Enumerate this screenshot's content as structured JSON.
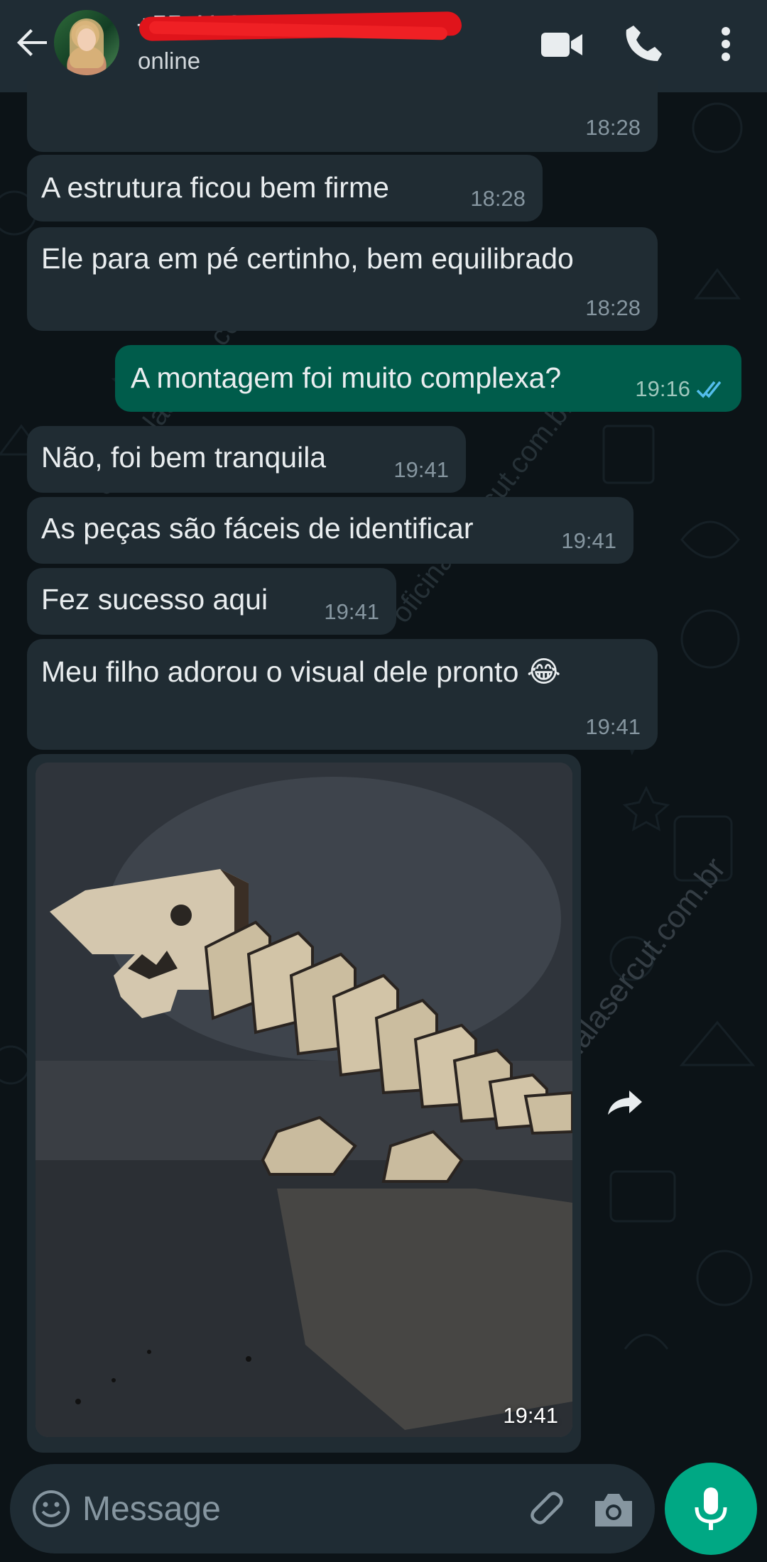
{
  "header": {
    "contact_name": "+55 41 99876-5320",
    "status": "online",
    "icons": [
      "back-arrow-icon",
      "video-call-icon",
      "voice-call-icon",
      "more-options-icon"
    ]
  },
  "watermark": "oficinalasercut.com.br",
  "messages": [
    {
      "direction": "in",
      "text": "",
      "time": "18:28"
    },
    {
      "direction": "in",
      "text": "A estrutura ficou bem firme",
      "time": "18:28"
    },
    {
      "direction": "in",
      "text": "Ele para em pé certinho, bem equilibrado",
      "time": "18:28"
    },
    {
      "direction": "out",
      "text": "A montagem foi muito complexa?",
      "time": "19:16",
      "read": true
    },
    {
      "direction": "in",
      "text": "Não, foi bem tranquila",
      "time": "19:41"
    },
    {
      "direction": "in",
      "text": "As peças são fáceis de identificar",
      "time": "19:41"
    },
    {
      "direction": "in",
      "text": "Fez sucesso aqui",
      "time": "19:41"
    },
    {
      "direction": "in",
      "text": "Meu filho adorou o visual dele pronto 😂",
      "time": "19:41"
    },
    {
      "direction": "in",
      "type": "image",
      "time": "19:41"
    }
  ],
  "composer": {
    "placeholder": "Message"
  },
  "colors": {
    "header_bg": "#1f2c34",
    "chat_bg": "#0c1317",
    "incoming_bubble": "#202c33",
    "outgoing_bubble": "#005c4b",
    "accent": "#00a884",
    "read_ticks": "#53bdeb"
  }
}
